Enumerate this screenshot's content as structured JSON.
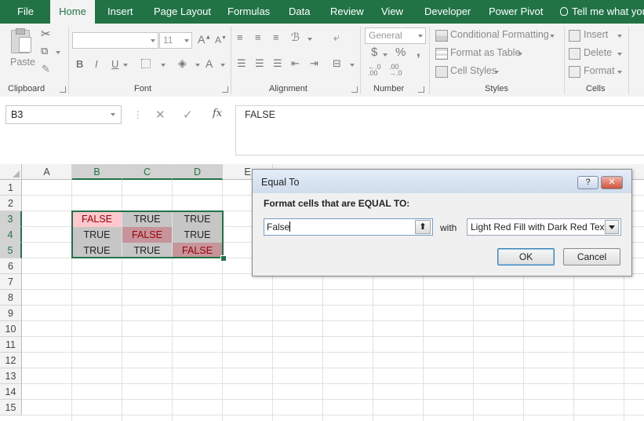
{
  "tabs": {
    "file": "File",
    "home": "Home",
    "insert": "Insert",
    "page_layout": "Page Layout",
    "formulas": "Formulas",
    "data": "Data",
    "review": "Review",
    "view": "View",
    "developer": "Developer",
    "power_pivot": "Power Pivot",
    "tell_me": "Tell me what you"
  },
  "ribbon": {
    "clipboard": {
      "paste": "Paste",
      "label": "Clipboard"
    },
    "font": {
      "size": "11",
      "grow": "A",
      "shrink": "A",
      "bold": "B",
      "italic": "I",
      "underline": "U",
      "font_color": "A",
      "label": "Font"
    },
    "alignment": {
      "label": "Alignment"
    },
    "number": {
      "format": "General",
      "currency": "$",
      "percent": "%",
      "comma": ",",
      "label": "Number"
    },
    "styles": {
      "conditional_formatting": "Conditional Formatting",
      "format_as_table": "Format as Table",
      "cell_styles": "Cell Styles",
      "label": "Styles"
    },
    "cells": {
      "insert": "Insert",
      "delete": "Delete",
      "format": "Format",
      "label": "Cells"
    }
  },
  "formula_bar": {
    "name_box": "B3",
    "cancel": "✕",
    "enter": "✓",
    "fx": "fx",
    "content": "FALSE"
  },
  "grid": {
    "columns": [
      "A",
      "B",
      "C",
      "D",
      "E"
    ],
    "rows": [
      "1",
      "2",
      "3",
      "4",
      "5",
      "6",
      "7",
      "8",
      "9",
      "10",
      "11",
      "12",
      "13",
      "14",
      "15"
    ],
    "cells": [
      [
        "FALSE",
        "TRUE",
        "TRUE"
      ],
      [
        "TRUE",
        "FALSE",
        "TRUE"
      ],
      [
        "TRUE",
        "TRUE",
        "FALSE"
      ]
    ]
  },
  "dialog": {
    "title": "Equal To",
    "help": "?",
    "close": "✕",
    "prompt": "Format cells that are EQUAL TO:",
    "value": "False",
    "with_label": "with",
    "format_option": "Light Red Fill with Dark Red Text",
    "ok": "OK",
    "cancel": "Cancel"
  },
  "colors": {
    "excel_green": "#217346",
    "highlight_fill": "#ffc7ce",
    "highlight_text": "#9c0006",
    "selection_fill": "#c6c6c6"
  }
}
